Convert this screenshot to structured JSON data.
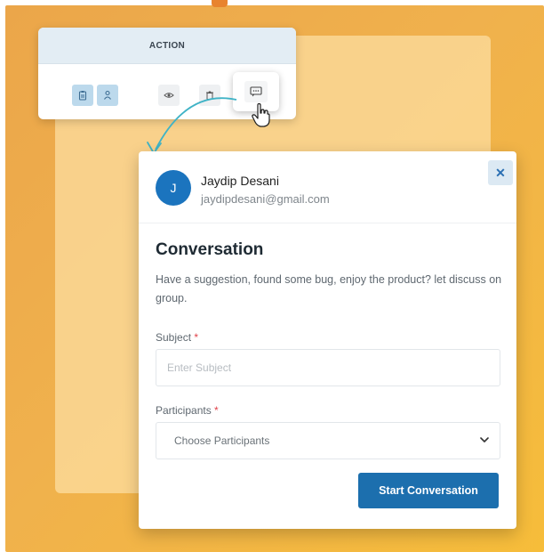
{
  "action_panel": {
    "header": "ACTION",
    "icons": [
      "clipboard-icon",
      "user-pin-icon",
      "eye-icon",
      "trash-icon",
      "chat-icon"
    ]
  },
  "dialog": {
    "user": {
      "initial": "J",
      "name": "Jaydip Desani",
      "email": "jaydipdesani@gmail.com"
    },
    "close_label": "✕",
    "title": "Conversation",
    "description": "Have a suggestion, found some bug, enjoy the product? let discuss on group.",
    "subject": {
      "label": "Subject",
      "required_mark": "*",
      "placeholder": "Enter Subject",
      "value": ""
    },
    "participants": {
      "label": "Participants",
      "required_mark": "*",
      "selected": "Choose Participants"
    },
    "submit_label": "Start Conversation"
  },
  "colors": {
    "background_orange": "#f0b14d",
    "primary_blue": "#1c6fae",
    "avatar_blue": "#1b74be",
    "arrow_teal": "#3fb3c6"
  }
}
